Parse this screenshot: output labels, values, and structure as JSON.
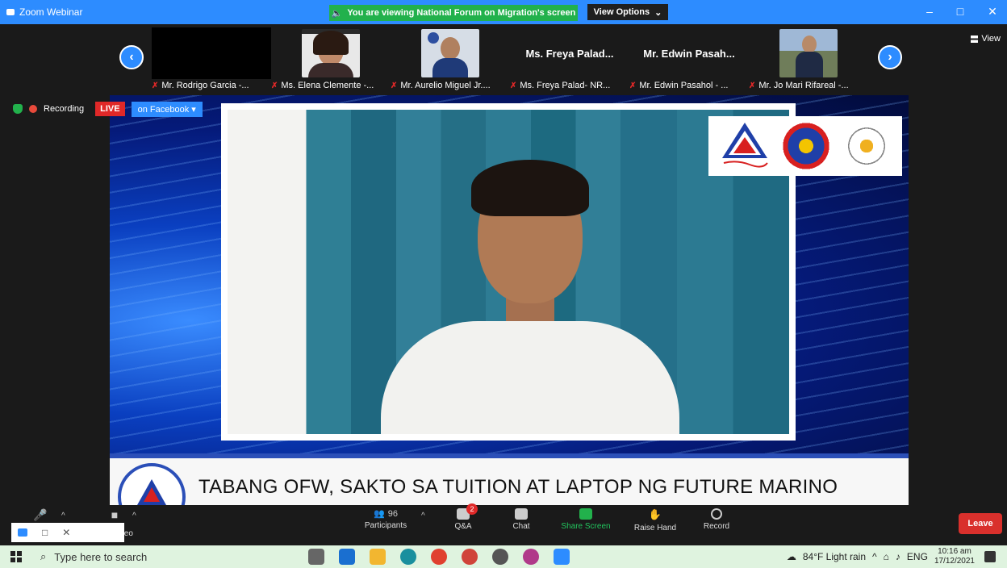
{
  "titlebar": {
    "app_title": "Zoom Webinar",
    "share_banner": "You are viewing National Forum on Migration's screen",
    "view_options": "View Options",
    "minimize": "–",
    "maximize": "□",
    "close": "✕"
  },
  "strip": {
    "view_label": "View",
    "thumbs": [
      {
        "label": "Mr. Rodrigo Garcia -...",
        "big": ""
      },
      {
        "label": "Ms. Elena Clemente -...",
        "big": ""
      },
      {
        "label": "Mr. Aurelio Miguel Jr....",
        "big": ""
      },
      {
        "label": "Ms. Freya Palad- NR...",
        "big": "Ms. Freya Palad..."
      },
      {
        "label": "Mr. Edwin Pasahol - ...",
        "big": "Mr. Edwin Pasah..."
      },
      {
        "label": "Mr. Jo Mari Rifareal -...",
        "big": ""
      }
    ]
  },
  "recording": {
    "label": "Recording",
    "live": "LIVE",
    "platform": "on Facebook"
  },
  "stage": {
    "lower_third": "TABANG OFW, SAKTO SA TUITION AT LAPTOP NG FUTURE MARINO"
  },
  "controls": {
    "participants_count": "96",
    "participants": "Participants",
    "qa": "Q&A",
    "qa_badge": "2",
    "chat": "Chat",
    "share": "Share Screen",
    "raise": "Raise Hand",
    "record": "Record",
    "video_partial": "ideo",
    "leave": "Leave"
  },
  "taskbar": {
    "search_placeholder": "Type here to search",
    "weather": "84°F  Light rain",
    "lang": "ENG",
    "time": "10:16 am",
    "date": "17/12/2021"
  },
  "colors": {
    "zoom_blue": "#2d8cff",
    "share_green": "#22b14c",
    "live_red": "#e02828"
  }
}
